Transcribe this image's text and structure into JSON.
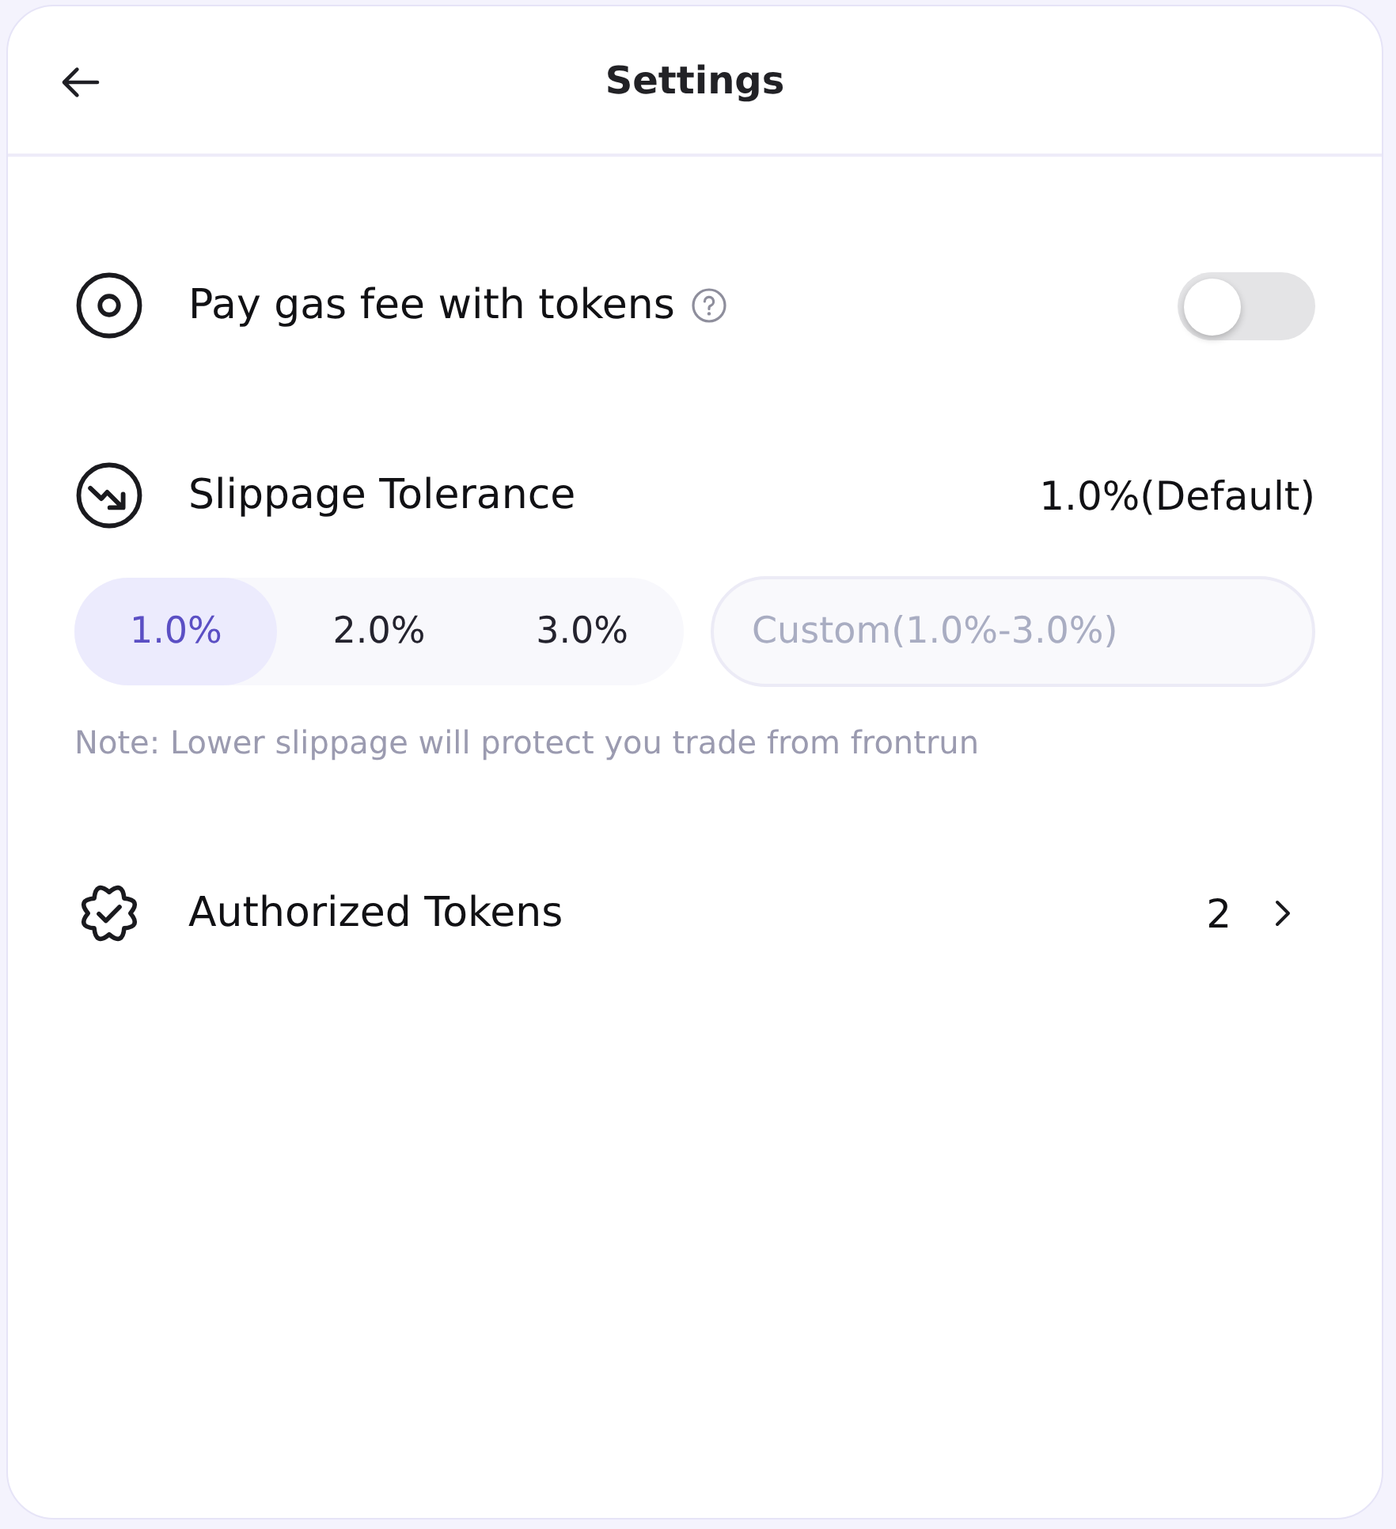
{
  "header": {
    "title": "Settings"
  },
  "gas_fee": {
    "label": "Pay gas fee with tokens",
    "on": false
  },
  "slippage": {
    "label": "Slippage Tolerance",
    "value": "1.0%(Default)",
    "options": [
      {
        "label": "1.0%",
        "selected": true
      },
      {
        "label": "2.0%",
        "selected": false
      },
      {
        "label": "3.0%",
        "selected": false
      }
    ],
    "custom": {
      "placeholder": "Custom(1.0%-3.0%)"
    },
    "note": "Note: Lower slippage will protect you trade from frontrun"
  },
  "authorized_tokens": {
    "label": "Authorized Tokens",
    "count": "2"
  }
}
